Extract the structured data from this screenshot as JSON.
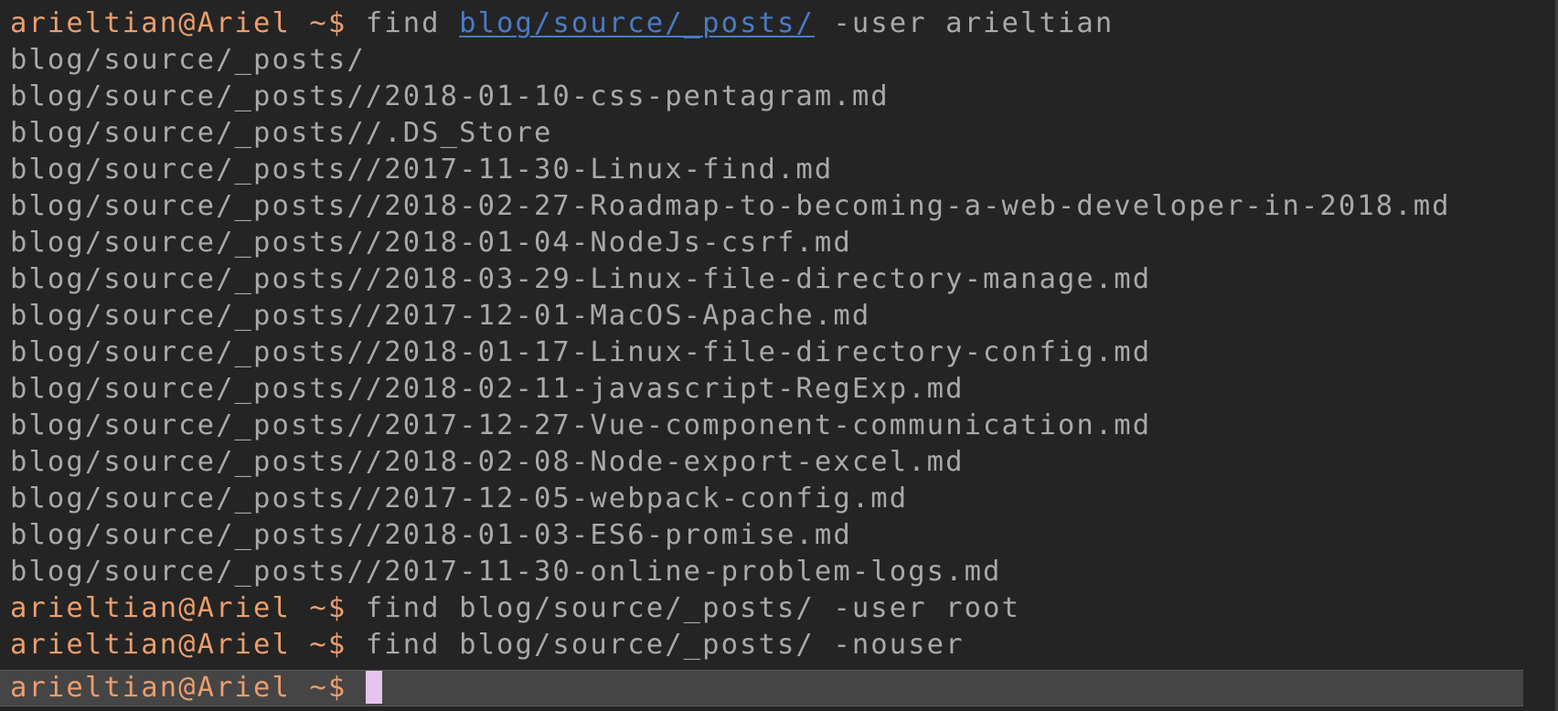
{
  "colors": {
    "background": "#242424",
    "prompt": "#ec9e6d",
    "text": "#a9a9a9",
    "link": "#4a7ac7",
    "cursor": "#e6c3ee",
    "current_line_bg": "#454545"
  },
  "prompt": "arieltian@Ariel ~$",
  "first_command": {
    "cmd": "find",
    "path": "blog/source/_posts/",
    "args": "-user arieltian"
  },
  "output": [
    "blog/source/_posts/",
    "blog/source/_posts//2018-01-10-css-pentagram.md",
    "blog/source/_posts//.DS_Store",
    "blog/source/_posts//2017-11-30-Linux-find.md",
    "blog/source/_posts//2018-02-27-Roadmap-to-becoming-a-web-developer-in-2018.md",
    "blog/source/_posts//2018-01-04-NodeJs-csrf.md",
    "blog/source/_posts//2018-03-29-Linux-file-directory-manage.md",
    "blog/source/_posts//2017-12-01-MacOS-Apache.md",
    "blog/source/_posts//2018-01-17-Linux-file-directory-config.md",
    "blog/source/_posts//2018-02-11-javascript-RegExp.md",
    "blog/source/_posts//2017-12-27-Vue-component-communication.md",
    "blog/source/_posts//2018-02-08-Node-export-excel.md",
    "blog/source/_posts//2017-12-05-webpack-config.md",
    "blog/source/_posts//2018-01-03-ES6-promise.md",
    "blog/source/_posts//2017-11-30-online-problem-logs.md"
  ],
  "later_commands": [
    "find blog/source/_posts/ -user root",
    "find blog/source/_posts/ -nouser"
  ]
}
